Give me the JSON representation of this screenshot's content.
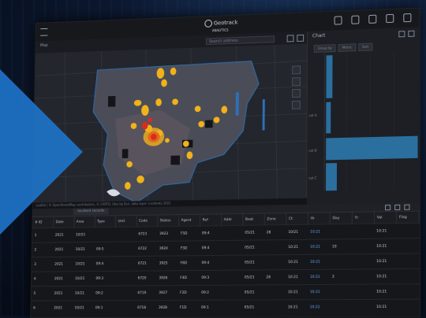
{
  "app": {
    "logo_line1": "Geotrack",
    "logo_line2": "ANALYTICS"
  },
  "map_panel": {
    "title": "Map",
    "search_placeholder": "Search address",
    "attribution": "Leaflet | © OpenStreetMap contributors, © CARTO, tiles by Esri, data layer: incidents 2021"
  },
  "chart_panel": {
    "title": "Chart",
    "chips": [
      "Group by",
      "Metric",
      "Sort"
    ],
    "axis_labels": [
      "cat A",
      "cat B",
      "cat C"
    ],
    "colors": {
      "bar": "#2a6f9e"
    }
  },
  "grid": {
    "tab_label": "Incident records",
    "columns": [
      "# ID",
      "Date",
      "Area",
      "Type",
      "Unit",
      "Code",
      "Status",
      "Agent",
      "Ref",
      "Addr",
      "Beat",
      "Zone",
      "Ct",
      "Hr",
      "Day",
      "Yr",
      "Val",
      "Flag"
    ],
    "rows": [
      [
        "1",
        "2021",
        "10/21",
        "",
        "",
        "6723",
        "3923",
        "F5D",
        "09:4",
        "",
        "05/21",
        "28",
        "10/21",
        "10:21",
        "",
        "",
        "10:21",
        ""
      ],
      [
        "2",
        "2021",
        "10/21",
        "09:5",
        "",
        "6722",
        "3924",
        "F5D",
        "09:4",
        "",
        "05/21",
        "",
        "10:21",
        "10:21",
        "19",
        "",
        "10:21",
        ""
      ],
      [
        "3",
        "2021",
        "10/21",
        "09:4",
        "",
        "6721",
        "3925",
        "F6D",
        "09:4",
        "",
        "05/21",
        "",
        "10:21",
        "10:21",
        "",
        "",
        "10:21",
        ""
      ],
      [
        "4",
        "2021",
        "10/21",
        "09:3",
        "",
        "6720",
        "3926",
        "F4D",
        "09:3",
        "",
        "05/21",
        "28",
        "10:21",
        "10:21",
        "3",
        "",
        "10:21",
        ""
      ],
      [
        "5",
        "2021",
        "10/21",
        "09:2",
        "",
        "6719",
        "3927",
        "F2D",
        "09:2",
        "",
        "05/21",
        "",
        "10:21",
        "10:21",
        "",
        "",
        "10:21",
        ""
      ],
      [
        "6",
        "2021",
        "10/21",
        "09:1",
        "",
        "6718",
        "3928",
        "F1D",
        "09:1",
        "",
        "05/21",
        "",
        "10:21",
        "10:21",
        "",
        "",
        "10:21",
        ""
      ]
    ]
  },
  "colors": {
    "accent": "#1e73c8",
    "hotspot": "#f2b21a",
    "hotspot_core": "#d82c1e"
  }
}
